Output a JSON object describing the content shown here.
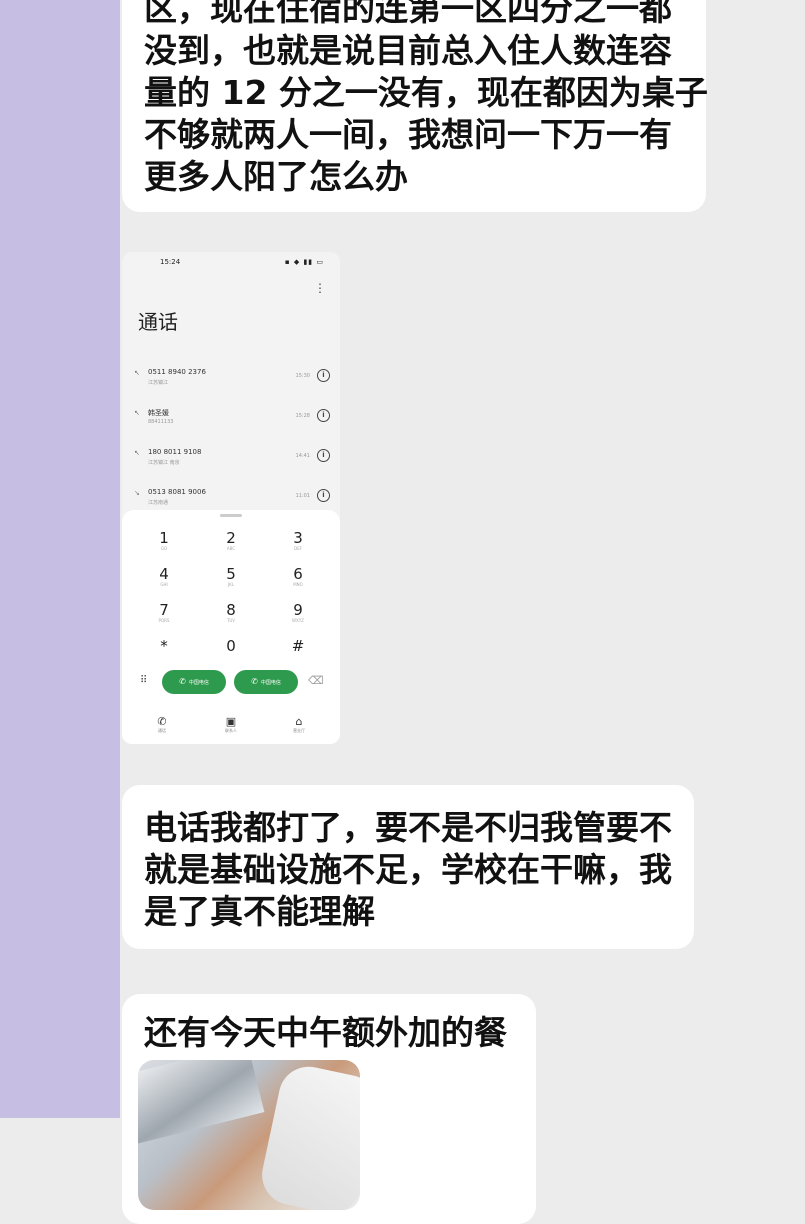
{
  "messages": [
    {
      "lines": [
        "区，现在住宿的连第一区四分之一都",
        "没到，也就是说目前总入住人数连容",
        "量的 12 分之一没有，现在都因为桌子",
        "不够就两人一间，我想问一下万一有",
        "更多人阳了怎么办"
      ]
    },
    {
      "lines": [
        "电话我都打了，要不是不归我管要不",
        "就是基础设施不足，学校在干嘛，我",
        "是了真不能理解"
      ]
    },
    {
      "lines": [
        "还有今天中午额外加的餐"
      ]
    }
  ],
  "phone_screenshot": {
    "status_time": "15:24",
    "title": "通话",
    "calls": [
      {
        "number": "0511 8940 2376",
        "sub": "江苏镇江",
        "time": "15:30"
      },
      {
        "number": "韩圣媛",
        "sub": "88411133",
        "time": "15:28"
      },
      {
        "number": "180 8011 9108",
        "sub": "江苏镇江 南京",
        "time": "14:41"
      },
      {
        "number": "0513 8081 9006",
        "sub": "江苏南通",
        "time": "11:01"
      }
    ],
    "keys": [
      {
        "digit": "1",
        "letters": "GO"
      },
      {
        "digit": "2",
        "letters": "ABC"
      },
      {
        "digit": "3",
        "letters": "DEF"
      },
      {
        "digit": "4",
        "letters": "GHI"
      },
      {
        "digit": "5",
        "letters": "JKL"
      },
      {
        "digit": "6",
        "letters": "MNO"
      },
      {
        "digit": "7",
        "letters": "PQRS"
      },
      {
        "digit": "8",
        "letters": "TUV"
      },
      {
        "digit": "9",
        "letters": "WXYZ"
      },
      {
        "digit": "*",
        "letters": ""
      },
      {
        "digit": "0",
        "letters": "+"
      },
      {
        "digit": "#",
        "letters": ""
      }
    ],
    "call_buttons": [
      "中国电信",
      "中国电信"
    ],
    "nav_tabs": [
      "通话",
      "联系人",
      "营业厅"
    ]
  },
  "colors": {
    "sidebar": "#c7bfe3",
    "background": "#ececec",
    "bubble": "#ffffff",
    "call_green": "#2e9a4e"
  }
}
